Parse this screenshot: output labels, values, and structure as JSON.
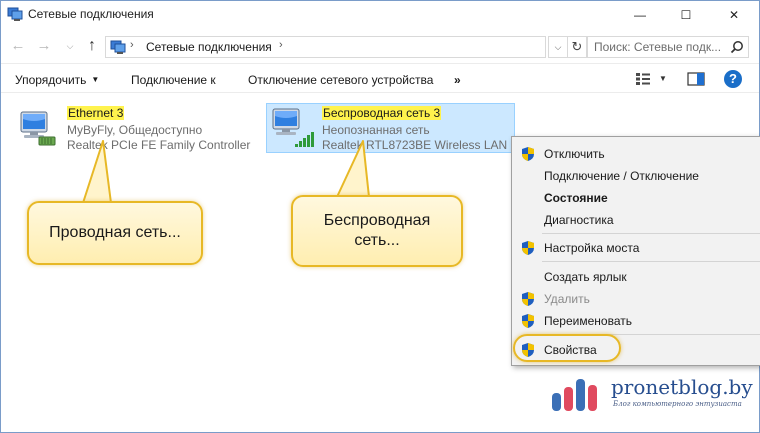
{
  "window": {
    "title": "Сетевые подключения",
    "icon": "network-connections-icon",
    "controls": {
      "minimize": "—",
      "maximize": "☐",
      "close": "✕"
    }
  },
  "nav": {
    "back": "←",
    "forward": "→",
    "recent": "⌵",
    "up": "↑",
    "breadcrumb_sep": "›",
    "address_text": "Сетевые подключения",
    "dropdown": "⌵",
    "refresh": "↻",
    "search_placeholder": "Поиск: Сетевые подк..."
  },
  "toolbar": {
    "organize": "Упорядочить",
    "organize_caret": "▼",
    "connect_to": "Подключение к",
    "disable_device": "Отключение сетевого устройства",
    "more": "»",
    "view_caret": "▼",
    "help": "?"
  },
  "items": {
    "ethernet": {
      "name": "Ethernet 3",
      "status": "MyByFly, Общедоступно",
      "adapter": "Realtek PCIe FE Family Controller"
    },
    "wifi": {
      "name": "Беспроводная сеть 3",
      "status": "Неопознанная сеть",
      "adapter": "Realtek RTL8723BE Wireless LAN 8..."
    }
  },
  "callouts": {
    "wired": "Проводная сеть...",
    "wireless_line1": "Беспроводная",
    "wireless_line2": "сеть..."
  },
  "context_menu": {
    "disable": "Отключить",
    "connect_disconnect": "Подключение / Отключение",
    "status": "Состояние",
    "diagnose": "Диагностика",
    "bridge": "Настройка моста",
    "shortcut": "Создать ярлык",
    "delete": "Удалить",
    "rename": "Переименовать",
    "properties": "Свойства"
  },
  "watermark": {
    "site": "pronetblog.by",
    "tagline": "Блог компьютерного энтузиаста"
  },
  "colors": {
    "accent": "#1a6ec8",
    "selection": "#cce8ff",
    "highlight": "#fff34d",
    "callout_border": "#e7b826",
    "watermark": "#274e8f"
  }
}
